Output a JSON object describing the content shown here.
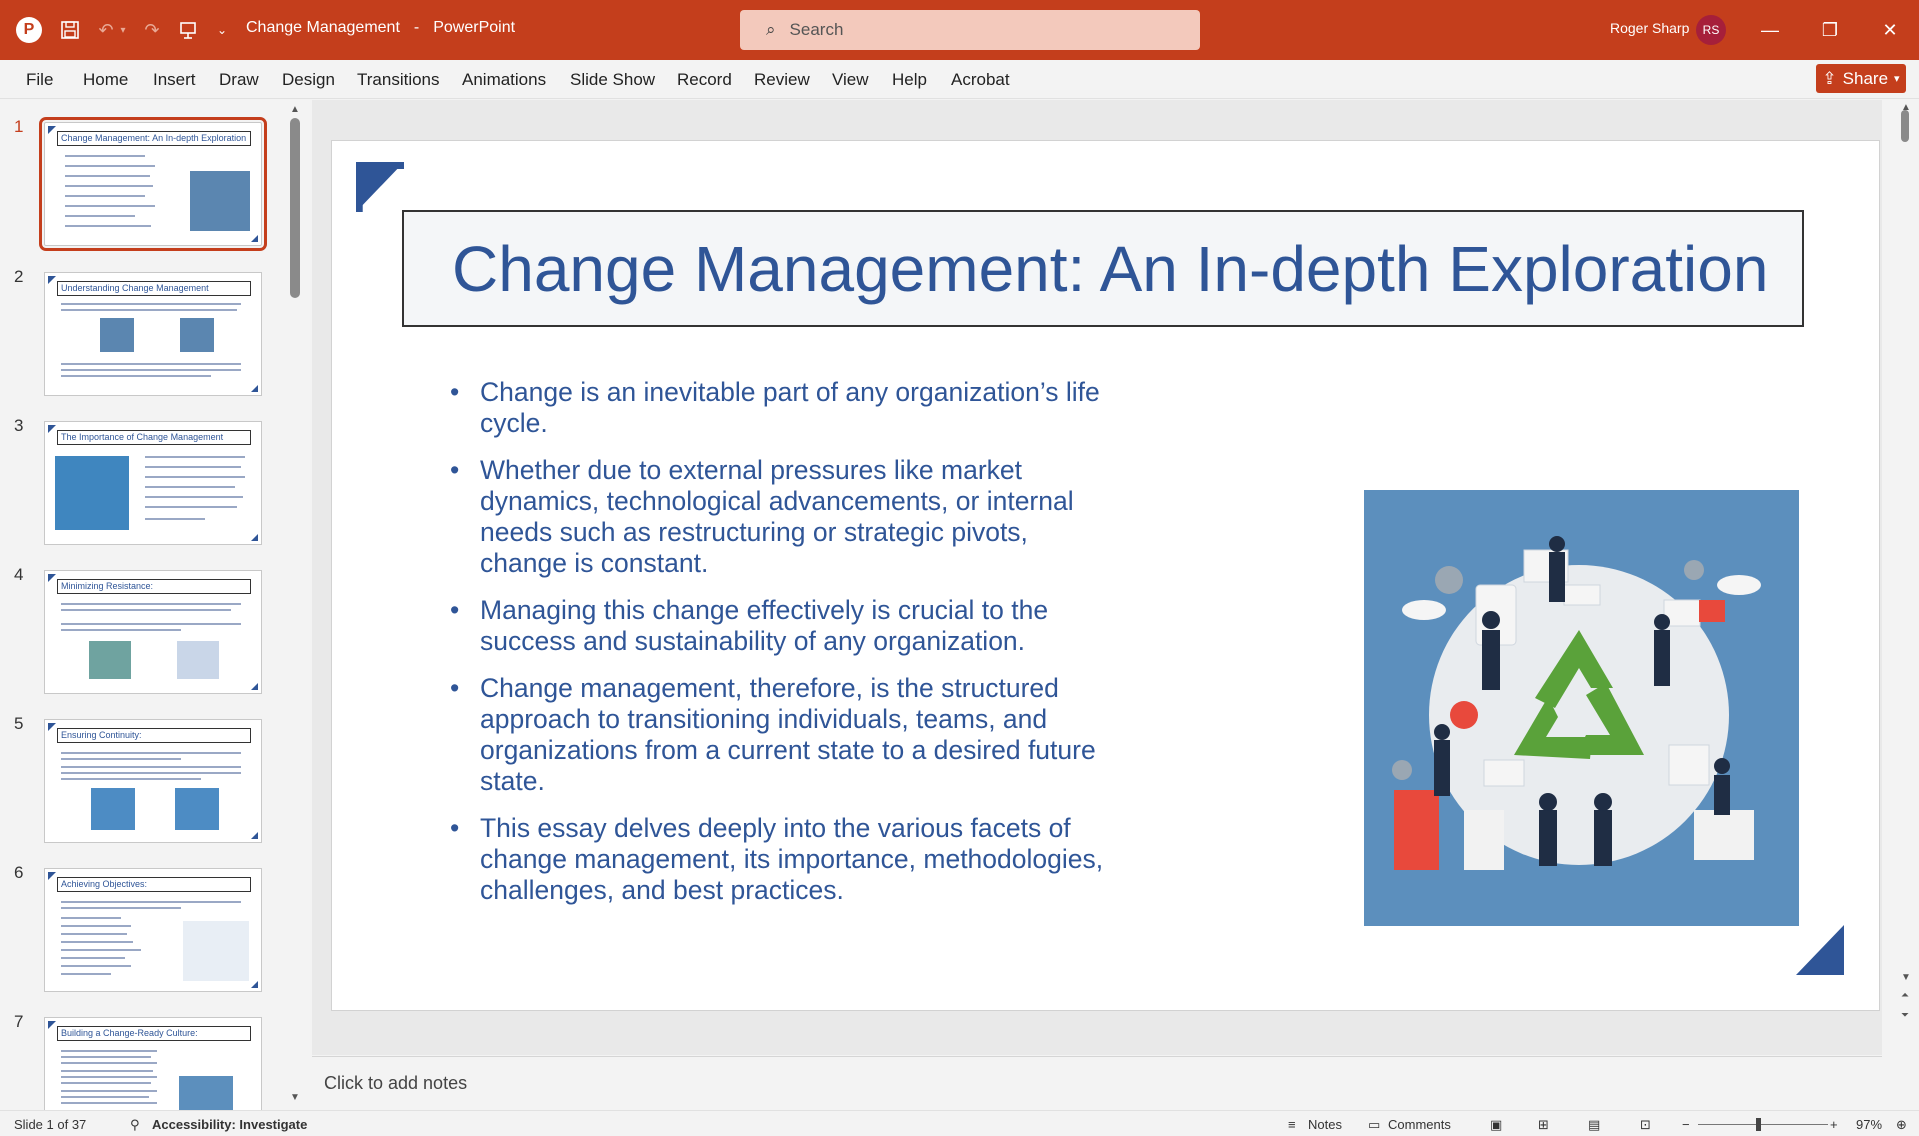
{
  "titlebar": {
    "app_letter": "P",
    "doc_name": "Change Management",
    "separator": "-",
    "app_name": "PowerPoint",
    "search_placeholder": "Search",
    "user_name": "Roger Sharp",
    "user_initials": "RS",
    "save_icon": "save-icon",
    "undo_icon": "undo-icon",
    "redo_icon": "redo-icon"
  },
  "ribbon": {
    "tabs": [
      "File",
      "Home",
      "Insert",
      "Draw",
      "Design",
      "Transitions",
      "Animations",
      "Slide Show",
      "Record",
      "Review",
      "View",
      "Help",
      "Acrobat"
    ],
    "share_label": "Share"
  },
  "thumbnails": [
    {
      "number": "1",
      "title": "Change Management: An In-depth Exploration",
      "layout": "text-image-right",
      "selected": true
    },
    {
      "number": "2",
      "title": "Understanding Change Management",
      "layout": "text-two-images",
      "selected": false
    },
    {
      "number": "3",
      "title": "The Importance of Change Management",
      "layout": "image-left-text",
      "selected": false
    },
    {
      "number": "4",
      "title": "Minimizing Resistance:",
      "layout": "text-two-images",
      "selected": false
    },
    {
      "number": "5",
      "title": "Ensuring Continuity:",
      "layout": "text-two-images",
      "selected": false
    },
    {
      "number": "6",
      "title": "Achieving Objectives:",
      "layout": "text-image-right",
      "selected": false
    },
    {
      "number": "7",
      "title": "Building a Change-Ready Culture:",
      "layout": "text-image-right",
      "selected": false
    }
  ],
  "slide": {
    "title": "Change Management: An In-depth Exploration",
    "bullets": [
      "Change is an inevitable part of any organization’s life cycle.",
      "Whether due to external pressures like market dynamics, technological advancements, or internal needs such as restructuring or strategic pivots, change is constant.",
      "Managing this change effectively is crucial to the success and sustainability of any organization.",
      "Change management, therefore, is the structured approach to transitioning individuals, teams, and organizations from a current state to a desired future state.",
      "This essay delves deeply into the various facets of change management, its importance, methodologies, challenges, and best practices."
    ],
    "accent_color": "#2f5597"
  },
  "notes": {
    "placeholder": "Click to add notes"
  },
  "statusbar": {
    "slide_info": "Slide 1 of 37",
    "accessibility": "Accessibility: Investigate",
    "notes_label": "Notes",
    "comments_label": "Comments",
    "zoom": "97%"
  },
  "colors": {
    "brand": "#c43e1c",
    "slide_text": "#2f5597"
  }
}
